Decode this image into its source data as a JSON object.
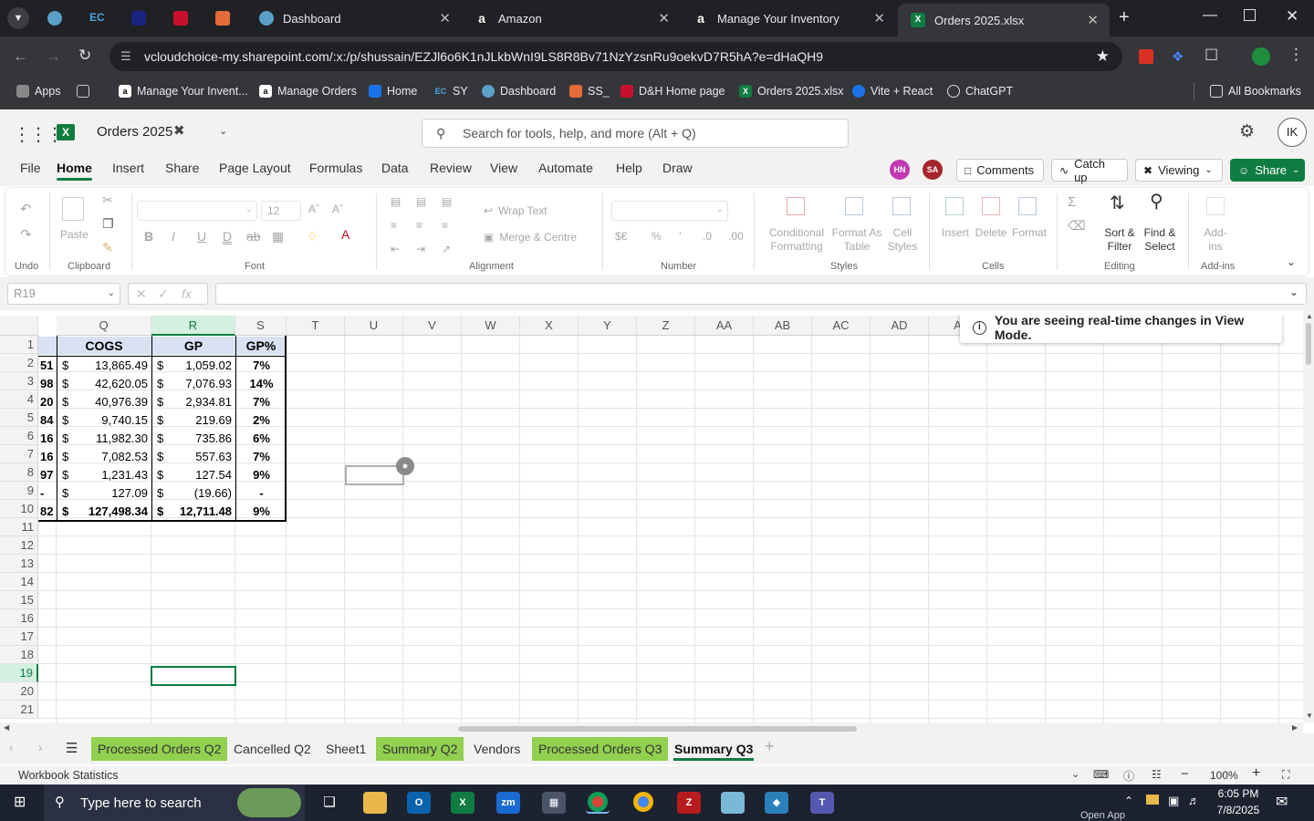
{
  "browser": {
    "tabs": [
      {
        "label": "Dashboard",
        "icon_color": "#5aa0c8"
      },
      {
        "label": "Amazon",
        "icon_color": "#ffffff"
      },
      {
        "label": "Manage Your Inventory",
        "icon_color": "#ffffff"
      },
      {
        "label": "Orders 2025.xlsx",
        "icon_color": "#107c41"
      }
    ],
    "url": "vcloudchoice-my.sharepoint.com/:x:/p/shussain/EZJl6o6K1nJLkbWnI9LS8R8Bv71NzYzsnRu9oekvD7R5hA?e=dHaQH9",
    "bookmarks": [
      "Apps",
      "Manage Your Invent...",
      "Manage Orders",
      "Home",
      "SY",
      "Dashboard",
      "SS_",
      "D&H Home page",
      "Orders 2025.xlsx",
      "Vite + React",
      "ChatGPT"
    ],
    "all_bookmarks": "All Bookmarks"
  },
  "excel": {
    "doc_title": "Orders 2025",
    "search_placeholder": "Search for tools, help, and more (Alt + Q)",
    "user_initials": "IK",
    "menu": [
      "File",
      "Home",
      "Insert",
      "Share",
      "Page Layout",
      "Formulas",
      "Data",
      "Review",
      "View",
      "Automate",
      "Help",
      "Draw"
    ],
    "presence": [
      "HN",
      "SA"
    ],
    "comments_label": "Comments",
    "catchup_label": "Catch up",
    "viewing_label": "Viewing",
    "share_label": "Share",
    "accent": "#107c41",
    "ribbon": {
      "undo": "Undo",
      "paste": "Paste",
      "clipboard": "Clipboard",
      "font_size": "12",
      "font": "Font",
      "wrap_text": "Wrap Text",
      "merge_centre": "Merge & Centre",
      "alignment": "Alignment",
      "number": "Number",
      "cond_fmt_1": "Conditional",
      "cond_fmt_2": "Formatting",
      "fmt_table_1": "Format As",
      "fmt_table_2": "Table",
      "cell_styles_1": "Cell",
      "cell_styles_2": "Styles",
      "styles": "Styles",
      "insert": "Insert",
      "delete": "Delete",
      "format": "Format",
      "cells": "Cells",
      "sort_1": "Sort &",
      "sort_2": "Filter",
      "find_1": "Find &",
      "find_2": "Select",
      "editing": "Editing",
      "addins": "Add-ins",
      "addins_grp": "Add-ins"
    },
    "name_box": "R19",
    "notice": "You are seeing real-time changes in View Mode.",
    "columns": [
      "Q",
      "R",
      "S",
      "T",
      "U",
      "V",
      "W",
      "X",
      "Y",
      "Z",
      "AA",
      "AB",
      "AC",
      "AD",
      "A"
    ],
    "rows": [
      "1",
      "2",
      "3",
      "4",
      "5",
      "6",
      "7",
      "8",
      "9",
      "10",
      "11",
      "12",
      "13",
      "14",
      "15",
      "16",
      "17",
      "18",
      "19",
      "20",
      "21"
    ],
    "table": {
      "headers": [
        "COGS",
        "GP",
        "GP%"
      ],
      "prev_col": [
        "51",
        "98",
        "20",
        "84",
        "16",
        "16",
        "97",
        "-",
        "82"
      ],
      "cogs": [
        "13,865.49",
        "42,620.05",
        "40,976.39",
        "9,740.15",
        "11,982.30",
        "7,082.53",
        "1,231.43",
        "127.09",
        "127,498.34"
      ],
      "gp": [
        "1,059.02",
        "7,076.93",
        "2,934.81",
        "219.69",
        "735.86",
        "557.63",
        "127.54",
        "(19.66)",
        "12,711.48"
      ],
      "gp_pct": [
        "7%",
        "14%",
        "7%",
        "2%",
        "6%",
        "7%",
        "9%",
        "-",
        "9%"
      ],
      "currency": "$"
    },
    "sheets": [
      {
        "label": "Processed Orders Q2",
        "green": true
      },
      {
        "label": "Cancelled Q2",
        "green": false
      },
      {
        "label": "Sheet1",
        "green": false
      },
      {
        "label": "Summary Q2",
        "green": true
      },
      {
        "label": "Vendors",
        "green": false
      },
      {
        "label": "Processed Orders Q3",
        "green": true
      },
      {
        "label": "Summary Q3",
        "green": false
      }
    ],
    "status_left": "Workbook Statistics",
    "zoom": "100%"
  },
  "taskbar": {
    "search_placeholder": "Type here to search",
    "time": "6:05 PM",
    "date": "7/8/2025",
    "open_app": "Open App"
  }
}
